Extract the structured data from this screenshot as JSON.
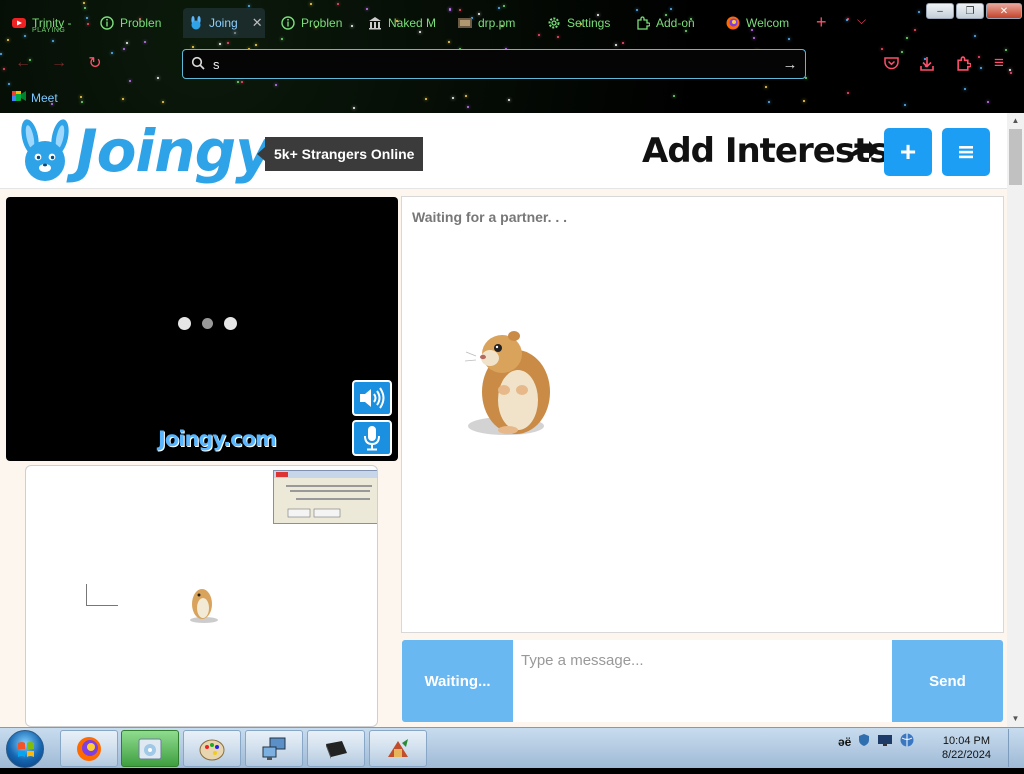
{
  "browser": {
    "tabs": [
      {
        "label": "Trinity -",
        "sub": "PLAYING",
        "icon": "youtube-icon",
        "active": false
      },
      {
        "label": "Problen",
        "icon": "info-icon",
        "active": false
      },
      {
        "label": "Joing",
        "icon": "joingy-rabbit-icon",
        "active": true
      },
      {
        "label": "Problen",
        "icon": "info-icon",
        "active": false
      },
      {
        "label": "Naked M",
        "icon": "museum-icon",
        "active": false
      },
      {
        "label": "drp.pm",
        "icon": "image-icon",
        "active": false
      },
      {
        "label": "Settings",
        "icon": "gear-icon",
        "active": false
      },
      {
        "label": "Add-on",
        "icon": "puzzle-icon",
        "active": false
      },
      {
        "label": "Welcom",
        "icon": "firefox-icon",
        "active": false
      }
    ],
    "url_value": "s",
    "bookmarks": [
      {
        "label": "Meet",
        "icon": "google-meet-icon"
      }
    ],
    "window_buttons": {
      "minimize": "–",
      "restore": "❐",
      "close": "✕"
    }
  },
  "page": {
    "logo_text": "Joingy",
    "online_badge": "5k+ Strangers Online",
    "add_interests": "Add Interests",
    "add_button": "+",
    "menu_button": "≡",
    "watermark": "Joingy.com",
    "chat_status": "Waiting for a partner. . .",
    "waiting_button": "Waiting...",
    "message_placeholder": "Type a message...",
    "send_button": "Send"
  },
  "taskbar": {
    "items": [
      "firefox-icon",
      "media-icon",
      "paint-icon",
      "network-icon",
      "device-icon",
      "game-icon"
    ],
    "tray": {
      "lang": "əë"
    },
    "time": "10:04 PM",
    "date": "8/22/2024"
  },
  "colors": {
    "accent": "#1b9ef3",
    "button_light": "#69b8f2",
    "page_bg": "#fdf6ee"
  }
}
